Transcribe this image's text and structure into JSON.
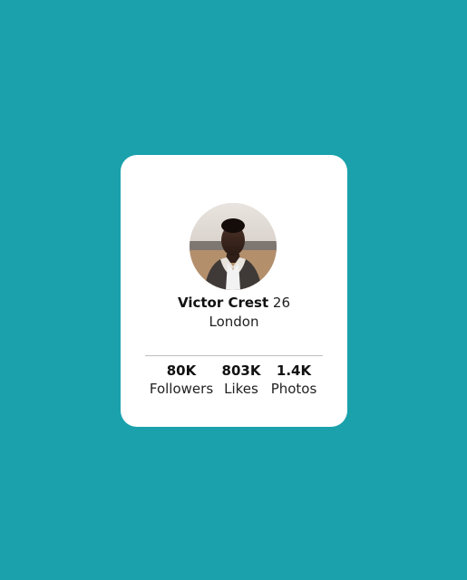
{
  "profile": {
    "name": "Victor Crest",
    "age": "26",
    "city": "London"
  },
  "stats": [
    {
      "value": "80K",
      "label": "Followers"
    },
    {
      "value": "803K",
      "label": "Likes"
    },
    {
      "value": "1.4K",
      "label": "Photos"
    }
  ],
  "colors": {
    "background": "#1aa1ac",
    "card": "#ffffff",
    "divider": "#bfbfbf"
  },
  "icons": {
    "avatar": "profile-photo"
  }
}
